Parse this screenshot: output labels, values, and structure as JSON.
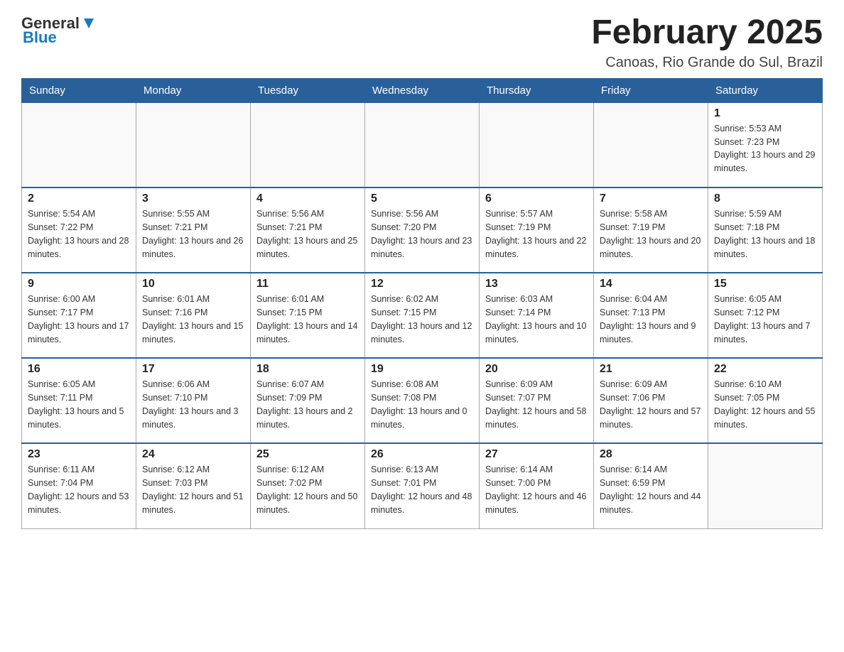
{
  "header": {
    "logo_general": "General",
    "logo_blue": "Blue",
    "title": "February 2025",
    "location": "Canoas, Rio Grande do Sul, Brazil"
  },
  "days_of_week": [
    "Sunday",
    "Monday",
    "Tuesday",
    "Wednesday",
    "Thursday",
    "Friday",
    "Saturday"
  ],
  "weeks": [
    [
      {
        "day": "",
        "info": ""
      },
      {
        "day": "",
        "info": ""
      },
      {
        "day": "",
        "info": ""
      },
      {
        "day": "",
        "info": ""
      },
      {
        "day": "",
        "info": ""
      },
      {
        "day": "",
        "info": ""
      },
      {
        "day": "1",
        "info": "Sunrise: 5:53 AM\nSunset: 7:23 PM\nDaylight: 13 hours and 29 minutes."
      }
    ],
    [
      {
        "day": "2",
        "info": "Sunrise: 5:54 AM\nSunset: 7:22 PM\nDaylight: 13 hours and 28 minutes."
      },
      {
        "day": "3",
        "info": "Sunrise: 5:55 AM\nSunset: 7:21 PM\nDaylight: 13 hours and 26 minutes."
      },
      {
        "day": "4",
        "info": "Sunrise: 5:56 AM\nSunset: 7:21 PM\nDaylight: 13 hours and 25 minutes."
      },
      {
        "day": "5",
        "info": "Sunrise: 5:56 AM\nSunset: 7:20 PM\nDaylight: 13 hours and 23 minutes."
      },
      {
        "day": "6",
        "info": "Sunrise: 5:57 AM\nSunset: 7:19 PM\nDaylight: 13 hours and 22 minutes."
      },
      {
        "day": "7",
        "info": "Sunrise: 5:58 AM\nSunset: 7:19 PM\nDaylight: 13 hours and 20 minutes."
      },
      {
        "day": "8",
        "info": "Sunrise: 5:59 AM\nSunset: 7:18 PM\nDaylight: 13 hours and 18 minutes."
      }
    ],
    [
      {
        "day": "9",
        "info": "Sunrise: 6:00 AM\nSunset: 7:17 PM\nDaylight: 13 hours and 17 minutes."
      },
      {
        "day": "10",
        "info": "Sunrise: 6:01 AM\nSunset: 7:16 PM\nDaylight: 13 hours and 15 minutes."
      },
      {
        "day": "11",
        "info": "Sunrise: 6:01 AM\nSunset: 7:15 PM\nDaylight: 13 hours and 14 minutes."
      },
      {
        "day": "12",
        "info": "Sunrise: 6:02 AM\nSunset: 7:15 PM\nDaylight: 13 hours and 12 minutes."
      },
      {
        "day": "13",
        "info": "Sunrise: 6:03 AM\nSunset: 7:14 PM\nDaylight: 13 hours and 10 minutes."
      },
      {
        "day": "14",
        "info": "Sunrise: 6:04 AM\nSunset: 7:13 PM\nDaylight: 13 hours and 9 minutes."
      },
      {
        "day": "15",
        "info": "Sunrise: 6:05 AM\nSunset: 7:12 PM\nDaylight: 13 hours and 7 minutes."
      }
    ],
    [
      {
        "day": "16",
        "info": "Sunrise: 6:05 AM\nSunset: 7:11 PM\nDaylight: 13 hours and 5 minutes."
      },
      {
        "day": "17",
        "info": "Sunrise: 6:06 AM\nSunset: 7:10 PM\nDaylight: 13 hours and 3 minutes."
      },
      {
        "day": "18",
        "info": "Sunrise: 6:07 AM\nSunset: 7:09 PM\nDaylight: 13 hours and 2 minutes."
      },
      {
        "day": "19",
        "info": "Sunrise: 6:08 AM\nSunset: 7:08 PM\nDaylight: 13 hours and 0 minutes."
      },
      {
        "day": "20",
        "info": "Sunrise: 6:09 AM\nSunset: 7:07 PM\nDaylight: 12 hours and 58 minutes."
      },
      {
        "day": "21",
        "info": "Sunrise: 6:09 AM\nSunset: 7:06 PM\nDaylight: 12 hours and 57 minutes."
      },
      {
        "day": "22",
        "info": "Sunrise: 6:10 AM\nSunset: 7:05 PM\nDaylight: 12 hours and 55 minutes."
      }
    ],
    [
      {
        "day": "23",
        "info": "Sunrise: 6:11 AM\nSunset: 7:04 PM\nDaylight: 12 hours and 53 minutes."
      },
      {
        "day": "24",
        "info": "Sunrise: 6:12 AM\nSunset: 7:03 PM\nDaylight: 12 hours and 51 minutes."
      },
      {
        "day": "25",
        "info": "Sunrise: 6:12 AM\nSunset: 7:02 PM\nDaylight: 12 hours and 50 minutes."
      },
      {
        "day": "26",
        "info": "Sunrise: 6:13 AM\nSunset: 7:01 PM\nDaylight: 12 hours and 48 minutes."
      },
      {
        "day": "27",
        "info": "Sunrise: 6:14 AM\nSunset: 7:00 PM\nDaylight: 12 hours and 46 minutes."
      },
      {
        "day": "28",
        "info": "Sunrise: 6:14 AM\nSunset: 6:59 PM\nDaylight: 12 hours and 44 minutes."
      },
      {
        "day": "",
        "info": ""
      }
    ]
  ]
}
